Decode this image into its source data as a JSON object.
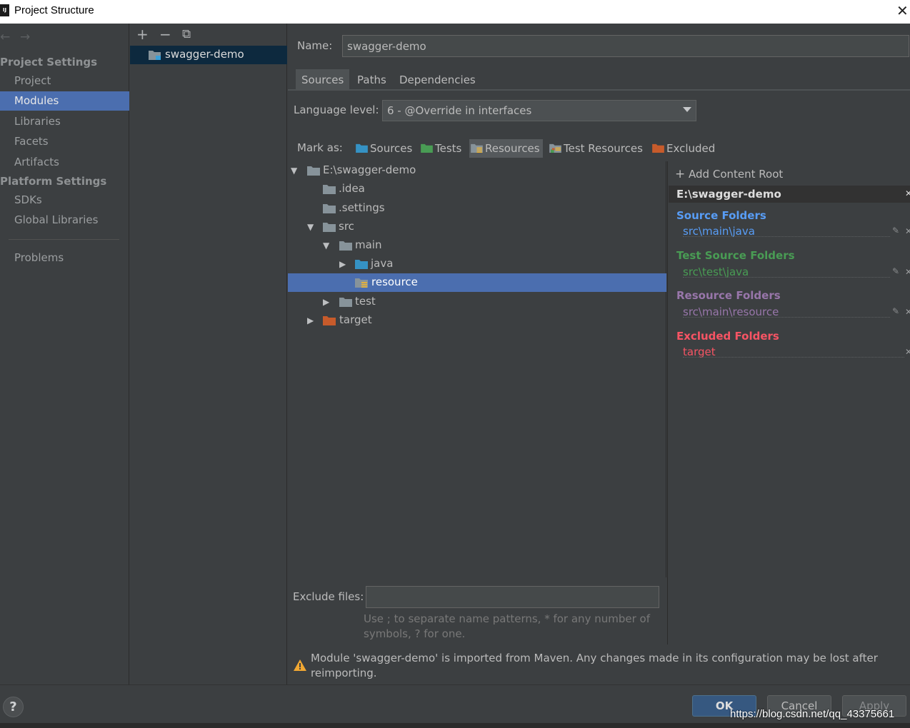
{
  "window": {
    "app_icon_text": "IJ",
    "title": "Project Structure",
    "close_glyph": "✕"
  },
  "sidebar": {
    "back_glyph": "←",
    "forward_glyph": "→",
    "project_settings_heading": "Project Settings",
    "platform_settings_heading": "Platform Settings",
    "items": [
      {
        "label": "Project"
      },
      {
        "label": "Modules",
        "selected": true
      },
      {
        "label": "Libraries"
      },
      {
        "label": "Facets"
      },
      {
        "label": "Artifacts"
      },
      {
        "label": "SDKs"
      },
      {
        "label": "Global Libraries"
      },
      {
        "label": "Problems"
      }
    ]
  },
  "modules_toolbar": {
    "add_glyph": "+",
    "remove_glyph": "−",
    "copy_glyph": "⧉"
  },
  "modules": [
    {
      "name": "swagger-demo",
      "selected": true
    }
  ],
  "editor": {
    "name_label": "Name:",
    "name_value": "swagger-demo",
    "tabs": [
      {
        "label": "Sources",
        "active": true
      },
      {
        "label": "Paths"
      },
      {
        "label": "Dependencies"
      }
    ],
    "language_level_label": "Language level:",
    "language_level_value": "6 - @Override in interfaces",
    "mark_as_label": "Mark as:",
    "mark_buttons": [
      {
        "label": "Sources",
        "icon": "sources-folder-icon",
        "color": "#3592c4"
      },
      {
        "label": "Tests",
        "icon": "tests-folder-icon",
        "color": "#499c54"
      },
      {
        "label": "Resources",
        "icon": "resources-folder-icon",
        "color": "#87939a",
        "active": true
      },
      {
        "label": "Test Resources",
        "icon": "test-resources-folder-icon",
        "color": "#87939a"
      },
      {
        "label": "Excluded",
        "icon": "excluded-folder-icon",
        "color": "#c75b2b"
      }
    ]
  },
  "tree": [
    {
      "label": "E:\\swagger-demo",
      "expanded": true,
      "type": "folder"
    },
    {
      "label": ".idea",
      "type": "folder"
    },
    {
      "label": ".settings",
      "type": "folder"
    },
    {
      "label": "src",
      "expanded": true,
      "type": "folder"
    },
    {
      "label": "main",
      "expanded": true,
      "type": "folder"
    },
    {
      "label": "java",
      "expanded": false,
      "type": "source"
    },
    {
      "label": "resource",
      "type": "resource",
      "selected": true
    },
    {
      "label": "test",
      "expanded": false,
      "type": "folder"
    },
    {
      "label": "target",
      "expanded": false,
      "type": "excluded"
    }
  ],
  "content_roots": {
    "add_label": "Add Content Root",
    "root_path": "E:\\swagger-demo",
    "groups": [
      {
        "title": "Source Folders",
        "path": "src\\main\\java",
        "title_color": "#589df6",
        "path_color": "#589df6"
      },
      {
        "title": "Test Source Folders",
        "path": "src\\test\\java",
        "title_color": "#499c54",
        "path_color": "#499c54"
      },
      {
        "title": "Resource Folders",
        "path": "src\\main\\resource",
        "title_color": "#9876aa",
        "path_color": "#9876aa"
      },
      {
        "title": "Excluded Folders",
        "path": "target",
        "title_color": "#f75464",
        "path_color": "#f75464"
      }
    ]
  },
  "exclude": {
    "label": "Exclude files:",
    "value": "",
    "hint": "Use ; to separate name patterns, * for any number of symbols, ? for one."
  },
  "warning": {
    "text": "Module 'swagger-demo' is imported from Maven. Any changes made in its configuration may be lost after reimporting."
  },
  "dialog": {
    "help_glyph": "?",
    "ok_label": "OK",
    "cancel_label": "Cancel",
    "apply_label": "Apply",
    "watermark": "https://blog.csdn.net/qq_43375661"
  }
}
